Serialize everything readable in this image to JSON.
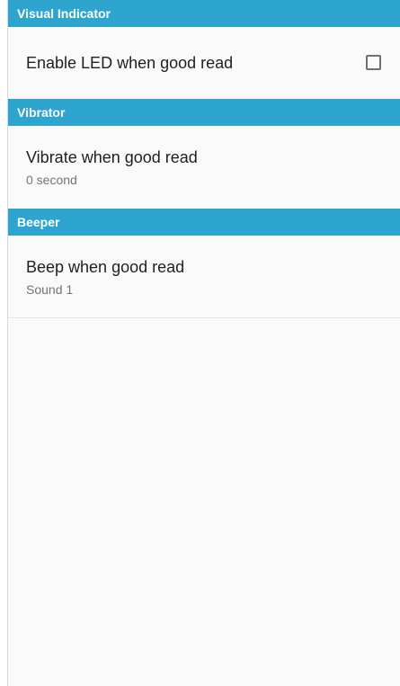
{
  "sections": {
    "visual_indicator": {
      "header": "Visual Indicator",
      "led_item": {
        "title": "Enable LED when good read",
        "checked": false
      }
    },
    "vibrator": {
      "header": "Vibrator",
      "vibrate_item": {
        "title": "Vibrate when good read",
        "summary": "0 second"
      }
    },
    "beeper": {
      "header": "Beeper",
      "beep_item": {
        "title": "Beep when good read",
        "summary": "Sound 1"
      }
    }
  },
  "colors": {
    "section_header_bg": "#2ea5cf",
    "section_header_text": "#ffffff",
    "background": "#fafafa",
    "title_text": "#1f1f1f",
    "summary_text": "#757575"
  }
}
